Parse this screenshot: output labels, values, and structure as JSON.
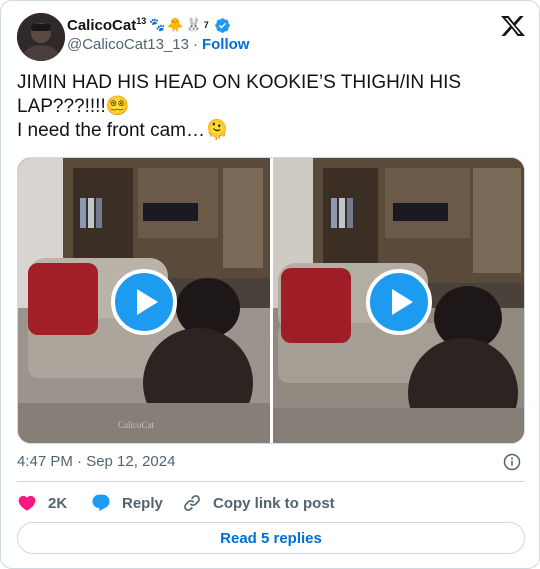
{
  "author": {
    "display_name": "CalicoCat",
    "superscript": "13",
    "badges": [
      "🐾",
      "🐥",
      "🐰"
    ],
    "badge_superscript": "7",
    "handle": "@CalicoCat13_13",
    "separator": "·",
    "follow_label": "Follow",
    "verified_color": "#1d9bf0"
  },
  "tweet": {
    "line1": "JIMIN HAD HIS HEAD ON KOOKIE’S THIGH/IN HIS",
    "line2": "LAP???!!!!😵‍💫",
    "line3": "I need the front cam…🫠"
  },
  "media": {
    "watermark": "CalicoCat",
    "videos": [
      {
        "icon": "play-icon"
      },
      {
        "icon": "play-icon"
      }
    ]
  },
  "meta": {
    "timestamp": "4:47 PM · Sep 12, 2024"
  },
  "actions": {
    "like_count": "2K",
    "reply_label": "Reply",
    "copy_label": "Copy link to post"
  },
  "footer": {
    "read_replies": "Read 5 replies"
  },
  "colors": {
    "accent": "#1d9bf0",
    "link": "#006fd6",
    "heart": "#f91880",
    "muted": "#536471",
    "border": "#cfd9de"
  }
}
